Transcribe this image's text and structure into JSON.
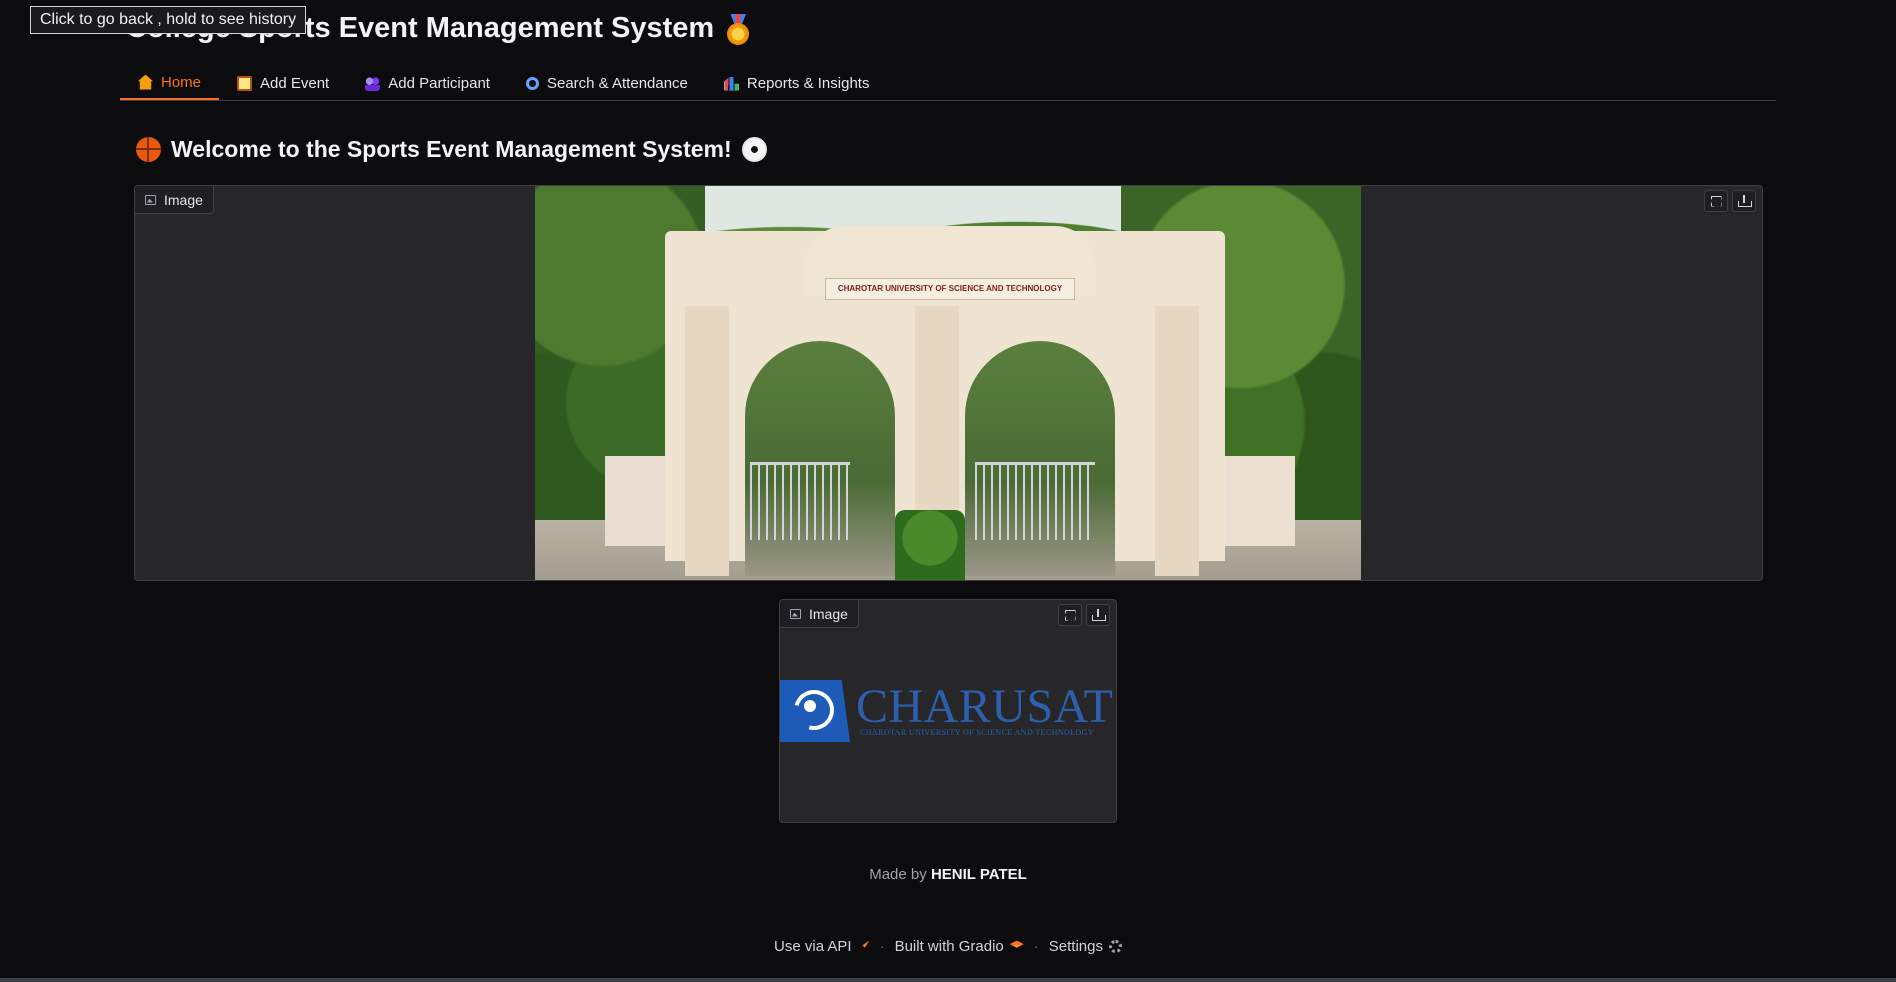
{
  "tooltip": "Click to go back , hold to see history",
  "app": {
    "title": "College Sports Event Management System"
  },
  "tabs": [
    {
      "label": "Home",
      "icon": "house-icon",
      "active": true
    },
    {
      "label": "Add Event",
      "icon": "clipboard-icon",
      "active": false
    },
    {
      "label": "Add Participant",
      "icon": "people-icon",
      "active": false
    },
    {
      "label": "Search & Attendance",
      "icon": "magnifier-icon",
      "active": false
    },
    {
      "label": "Reports & Insights",
      "icon": "bar-chart-icon",
      "active": false
    }
  ],
  "home": {
    "welcome": "Welcome to the Sports Event Management System!",
    "campus_image": {
      "label": "Image",
      "sign_text": "CHAROTAR UNIVERSITY OF SCIENCE AND TECHNOLOGY"
    },
    "logo_image": {
      "label": "Image",
      "logo_text": "CHARUSAT",
      "logo_subtext": "CHAROTAR UNIVERSITY OF SCIENCE AND TECHNOLOGY"
    },
    "made_by_prefix": "Made by",
    "made_by_name": "HENIL PATEL"
  },
  "footer": {
    "api": "Use via API",
    "built": "Built with Gradio",
    "settings": "Settings"
  },
  "colors": {
    "accent": "#f97316",
    "background": "#0c0c0f",
    "panel": "#27272a",
    "logo_blue": "#2c5fad"
  }
}
